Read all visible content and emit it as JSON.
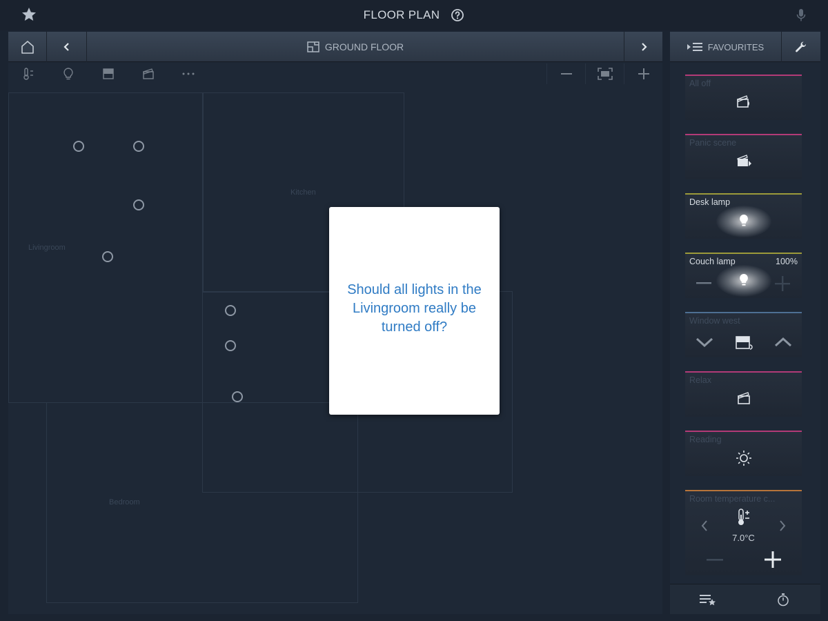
{
  "app": {
    "title": "FLOOR PLAN"
  },
  "navigation": {
    "floor_label": "GROUND FLOOR"
  },
  "floor_plan": {
    "rooms": [
      "Livingroom",
      "Kitchen",
      "Bedroom"
    ]
  },
  "dialog": {
    "message": "Should all lights in the Livingroom really be turned off?"
  },
  "favourites": {
    "header_label": "FAVOURITES",
    "tiles": [
      {
        "title": "All off"
      },
      {
        "title": "Panic scene"
      },
      {
        "title": "Desk lamp"
      },
      {
        "title": "Couch lamp",
        "value": "100%"
      },
      {
        "title": "Window west"
      },
      {
        "title": "Relax"
      },
      {
        "title": "Reading"
      },
      {
        "title": "Room temperature c...",
        "value": "7.0°C"
      }
    ]
  },
  "colors": {
    "background": "#1b2431",
    "dialog_text": "#2f7bc4",
    "scene_accent": "#b33a77",
    "lamp_accent": "#9c9a3a",
    "blind_accent": "#4e6f93",
    "climate_accent": "#b7743a"
  }
}
